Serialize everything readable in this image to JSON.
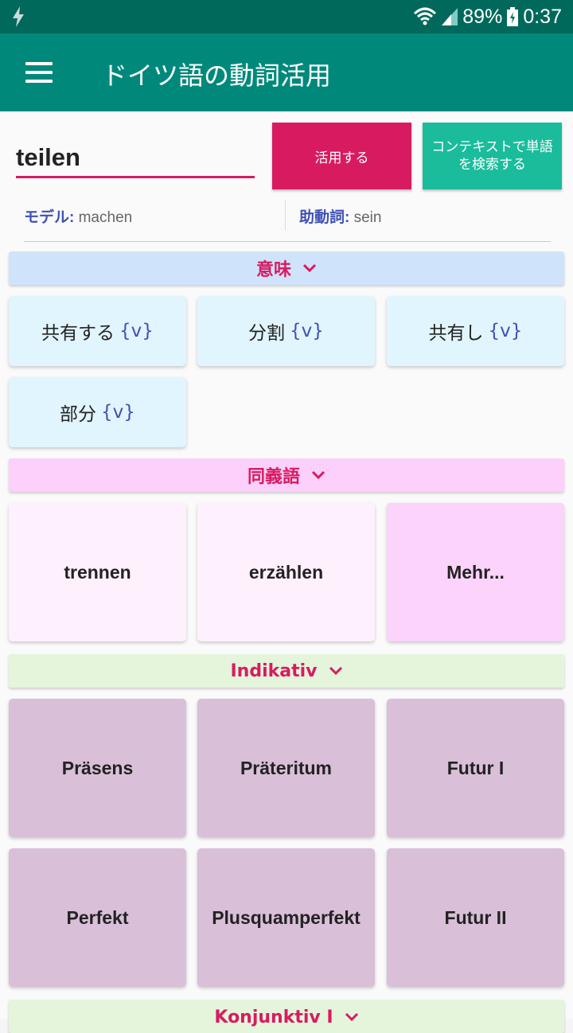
{
  "status_bar": {
    "battery": "89%",
    "time": "0:37"
  },
  "app_bar": {
    "title": "ドイツ語の動詞活用"
  },
  "search": {
    "verb_value": "teilen",
    "conjugate_label": "活用する",
    "context_label": "コンテキストで単語を検索する"
  },
  "model": {
    "model_label": "モデル:",
    "model_value": " machen",
    "aux_label": "助動詞:",
    "aux_value": " sein"
  },
  "sections": {
    "meaning": "意味",
    "synonyms": "同義語",
    "indikativ": "Indikativ",
    "konjunktiv": "Konjunktiv I"
  },
  "meanings": [
    {
      "word": "共有する",
      "tag": "{v}"
    },
    {
      "word": "分割",
      "tag": "{v}"
    },
    {
      "word": "共有し",
      "tag": "{v}"
    },
    {
      "word": "部分",
      "tag": "{v}"
    }
  ],
  "synonyms": [
    "trennen",
    "erzählen",
    "Mehr..."
  ],
  "tenses": [
    "Präsens",
    "Präteritum",
    "Futur I",
    "Perfekt",
    "Plusquamperfekt",
    "Futur II"
  ],
  "colors": {
    "status_bar": "#00695c",
    "app_bar": "#00897b",
    "accent": "#d81b60",
    "context_button": "#1abc9c",
    "meaning_header": "#cfe3fb",
    "synonym_header": "#fcd0fb",
    "indikativ_header": "#e4f5dc",
    "tense_card": "#d9bfd8"
  }
}
